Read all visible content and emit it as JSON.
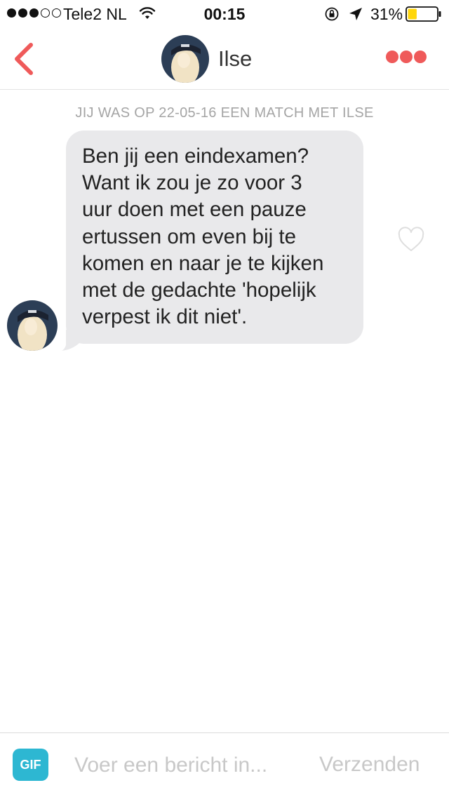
{
  "status_bar": {
    "carrier": "Tele2 NL",
    "time": "00:15",
    "battery": "31%",
    "battery_level": 0.31,
    "signal_bars_filled": 3,
    "signal_bars_total": 5,
    "battery_color": "#ffd60a"
  },
  "header": {
    "name": "Ilse",
    "back_icon": "chevron-left-icon",
    "more_icon": "ellipsis-icon",
    "accent_color": "#ef5a5a"
  },
  "conversation": {
    "match_info": "JIJ WAS OP 22-05-16 EEN MATCH MET ILSE",
    "messages": [
      {
        "text": "Ben jij een eindexamen?\nWant ik zou je zo voor 3\nuur doen met een pauze\nertussen om even bij te\nkomen en naar je te kijken\nmet de gedachte 'hopelijk\nverpest ik dit niet'.",
        "liked": false
      }
    ]
  },
  "input_bar": {
    "gif_label": "GIF",
    "placeholder": "Voer een bericht in...",
    "value": "",
    "send_label": "Verzenden",
    "gif_color": "#2db7d2"
  }
}
